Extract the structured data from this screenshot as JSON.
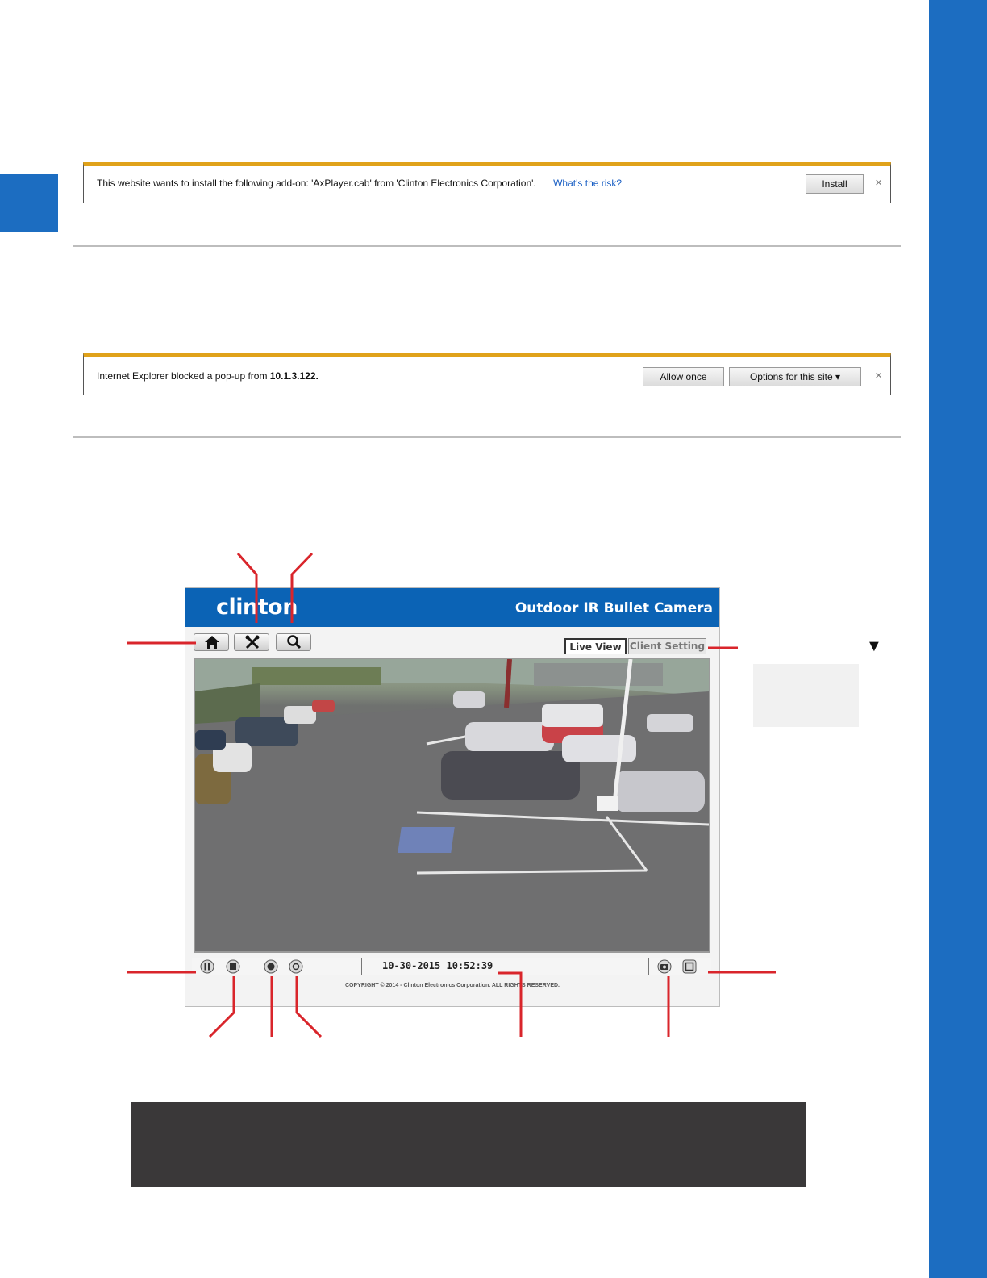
{
  "ie_install_bar": {
    "message": "This website wants to install the following add-on: 'AxPlayer.cab' from 'Clinton Electronics Corporation'.",
    "risk_link": "What's the risk?",
    "install_label": "Install",
    "close_glyph": "×"
  },
  "ie_popup_bar": {
    "message_prefix": "Internet Explorer blocked a pop-up from ",
    "address": "10.1.3.122.",
    "allow_label": "Allow once",
    "options_label": "Options for this site ▾",
    "close_glyph": "×"
  },
  "camera_ui": {
    "logo": "clinton",
    "title": "Outdoor IR Bullet Camera",
    "toolbar": {
      "home_icon": "home-icon",
      "setup_icon": "tools-icon",
      "search_icon": "search-icon"
    },
    "tabs": [
      "Live View",
      "Client Setting"
    ],
    "timestamp": "10-30-2015 10:52:39",
    "copyright": "COPYRIGHT © 2014 - Clinton Electronics Corporation. ALL RIGHTS RESERVED.",
    "controls_left": [
      "pause-icon",
      "stop-icon",
      "record-icon",
      "audio-icon"
    ],
    "controls_right": [
      "snapshot-icon",
      "fullscreen-icon"
    ]
  },
  "marker": "▼",
  "colors": {
    "brand_blue": "#1c6dc1",
    "camera_header": "#0b63b5",
    "ie_accent": "#e0a21a",
    "callout_red": "#d9252b",
    "dark_panel": "#3a3839"
  }
}
